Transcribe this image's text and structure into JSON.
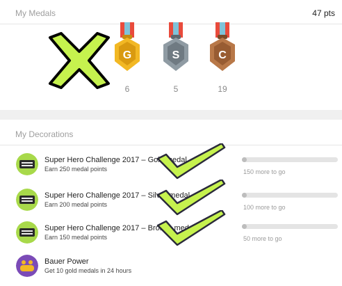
{
  "medals": {
    "title": "My Medals",
    "points": "47 pts",
    "items": [
      {
        "letter": "G",
        "count": "6",
        "color": "#f2b824",
        "dark": "#d99a10",
        "ribbon": "#e94b3c"
      },
      {
        "letter": "S",
        "count": "5",
        "color": "#8f9ba3",
        "dark": "#6f7a82",
        "ribbon": "#e94b3c"
      },
      {
        "letter": "C",
        "count": "19",
        "color": "#b87848",
        "dark": "#985c32",
        "ribbon": "#e94b3c"
      }
    ]
  },
  "decorations": {
    "title": "My Decorations",
    "items": [
      {
        "title": "Super Hero Challenge 2017 – Gold medal",
        "sub": "Earn 250 medal points",
        "progress_text": "150 more to go",
        "progress": 0.05
      },
      {
        "title": "Super Hero Challenge 2017 – Silver medal",
        "sub": "Earn 200 medal points",
        "progress_text": "100 more to go",
        "progress": 0.05
      },
      {
        "title": "Super Hero Challenge 2017 – Bronze medal",
        "sub": "Earn 150 medal points",
        "progress_text": "50 more to go",
        "progress": 0.05
      },
      {
        "title": "Bauer Power",
        "sub": "Get 10 gold medals in 24 hours"
      }
    ]
  },
  "colors": {
    "mark_green": "#c6f24e",
    "accent_gray": "#bdbdbd"
  }
}
